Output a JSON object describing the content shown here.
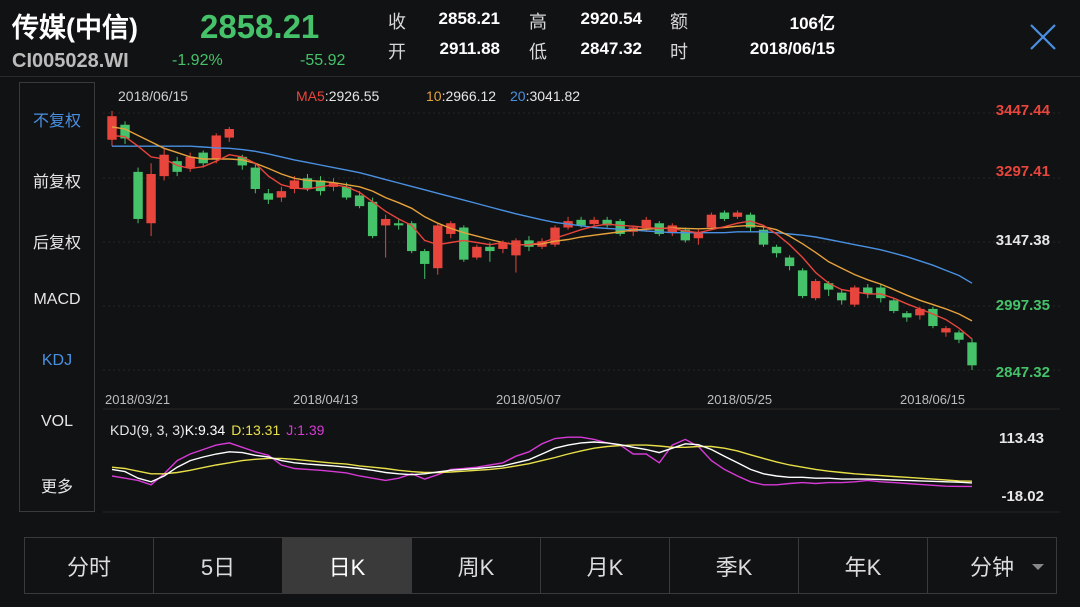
{
  "header": {
    "title": "传媒(中信)",
    "code": "CI005028.WI",
    "price": "2858.21",
    "change_pct": "-1.92%",
    "change": "-55.92",
    "quote": [
      {
        "label": "收",
        "value": "2858.21"
      },
      {
        "label": "开",
        "value": "2911.88"
      },
      {
        "label": "高",
        "value": "2920.54"
      },
      {
        "label": "低",
        "value": "2847.32"
      },
      {
        "label": "额",
        "value": "106亿"
      },
      {
        "label": "时",
        "value": "2018/06/15"
      }
    ]
  },
  "sidebar": {
    "items": [
      {
        "label": "不复权",
        "active": true
      },
      {
        "label": "前复权",
        "active": false
      },
      {
        "label": "后复权",
        "active": false
      },
      {
        "label": "MACD",
        "active": false
      },
      {
        "label": "KDJ",
        "active": true
      },
      {
        "label": "VOL",
        "active": false
      },
      {
        "label": "更多",
        "active": false
      }
    ]
  },
  "tabs": [
    {
      "label": "分时",
      "active": false
    },
    {
      "label": "5日",
      "active": false
    },
    {
      "label": "日K",
      "active": true
    },
    {
      "label": "周K",
      "active": false
    },
    {
      "label": "月K",
      "active": false
    },
    {
      "label": "季K",
      "active": false
    },
    {
      "label": "年K",
      "active": false
    },
    {
      "label": "分钟",
      "active": false,
      "dropdown": true
    }
  ],
  "icons": {
    "close": "close-icon",
    "dropdown": "caret-down-icon"
  },
  "colors": {
    "up": "#e8453c",
    "down": "#45c26a",
    "ma5": "#e8453c",
    "ma10": "#e6a23c",
    "ma20": "#4a90e2",
    "k": "#ffffff",
    "d": "#e8e04a",
    "j": "#d63ad6",
    "accent": "#4a90e2"
  },
  "chart_data": [
    {
      "type": "candlestick",
      "title": "",
      "date_label": "2018/06/15",
      "ma_legend": [
        {
          "name": "MA5",
          "value": "2926.55"
        },
        {
          "name": "10",
          "value": "2966.12"
        },
        {
          "name": "20",
          "value": "3041.82"
        }
      ],
      "y_ticks": [
        "3447.44",
        "3297.41",
        "3147.38",
        "2997.35",
        "2847.32"
      ],
      "ylim": [
        2847.32,
        3447.44
      ],
      "x_ticks": [
        "2018/03/21",
        "2018/04/13",
        "2018/05/07",
        "2018/05/25",
        "2018/06/15"
      ],
      "x_tick_index": [
        0,
        16,
        32,
        48,
        64
      ],
      "candles": [
        {
          "o": 3385,
          "c": 3440,
          "h": 3452,
          "l": 3370
        },
        {
          "o": 3420,
          "c": 3388,
          "h": 3428,
          "l": 3375
        },
        {
          "o": 3310,
          "c": 3200,
          "h": 3320,
          "l": 3190
        },
        {
          "o": 3190,
          "c": 3305,
          "h": 3330,
          "l": 3160
        },
        {
          "o": 3300,
          "c": 3350,
          "h": 3365,
          "l": 3290
        },
        {
          "o": 3335,
          "c": 3310,
          "h": 3345,
          "l": 3300
        },
        {
          "o": 3320,
          "c": 3345,
          "h": 3355,
          "l": 3310
        },
        {
          "o": 3355,
          "c": 3330,
          "h": 3360,
          "l": 3320
        },
        {
          "o": 3340,
          "c": 3395,
          "h": 3400,
          "l": 3330
        },
        {
          "o": 3390,
          "c": 3410,
          "h": 3415,
          "l": 3380
        },
        {
          "o": 3345,
          "c": 3325,
          "h": 3350,
          "l": 3315
        },
        {
          "o": 3320,
          "c": 3270,
          "h": 3330,
          "l": 3260
        },
        {
          "o": 3260,
          "c": 3245,
          "h": 3270,
          "l": 3235
        },
        {
          "o": 3250,
          "c": 3265,
          "h": 3275,
          "l": 3240
        },
        {
          "o": 3270,
          "c": 3290,
          "h": 3300,
          "l": 3260
        },
        {
          "o": 3295,
          "c": 3270,
          "h": 3305,
          "l": 3265
        },
        {
          "o": 3290,
          "c": 3265,
          "h": 3300,
          "l": 3255
        },
        {
          "o": 3275,
          "c": 3285,
          "h": 3295,
          "l": 3265
        },
        {
          "o": 3275,
          "c": 3250,
          "h": 3285,
          "l": 3245
        },
        {
          "o": 3255,
          "c": 3230,
          "h": 3265,
          "l": 3225
        },
        {
          "o": 3240,
          "c": 3160,
          "h": 3250,
          "l": 3155
        },
        {
          "o": 3185,
          "c": 3200,
          "h": 3210,
          "l": 3110
        },
        {
          "o": 3190,
          "c": 3185,
          "h": 3200,
          "l": 3175
        },
        {
          "o": 3190,
          "c": 3125,
          "h": 3195,
          "l": 3120
        },
        {
          "o": 3125,
          "c": 3095,
          "h": 3130,
          "l": 3060
        },
        {
          "o": 3085,
          "c": 3185,
          "h": 3190,
          "l": 3070
        },
        {
          "o": 3165,
          "c": 3190,
          "h": 3195,
          "l": 3155
        },
        {
          "o": 3180,
          "c": 3105,
          "h": 3185,
          "l": 3100
        },
        {
          "o": 3110,
          "c": 3135,
          "h": 3140,
          "l": 3105
        },
        {
          "o": 3135,
          "c": 3125,
          "h": 3145,
          "l": 3100
        },
        {
          "o": 3130,
          "c": 3145,
          "h": 3150,
          "l": 3120
        },
        {
          "o": 3115,
          "c": 3150,
          "h": 3155,
          "l": 3075
        },
        {
          "o": 3150,
          "c": 3135,
          "h": 3160,
          "l": 3125
        },
        {
          "o": 3135,
          "c": 3148,
          "h": 3155,
          "l": 3130
        },
        {
          "o": 3140,
          "c": 3180,
          "h": 3185,
          "l": 3135
        },
        {
          "o": 3180,
          "c": 3195,
          "h": 3205,
          "l": 3175
        },
        {
          "o": 3198,
          "c": 3185,
          "h": 3205,
          "l": 3180
        },
        {
          "o": 3188,
          "c": 3198,
          "h": 3205,
          "l": 3183
        },
        {
          "o": 3198,
          "c": 3185,
          "h": 3205,
          "l": 3180
        },
        {
          "o": 3195,
          "c": 3165,
          "h": 3200,
          "l": 3160
        },
        {
          "o": 3170,
          "c": 3180,
          "h": 3185,
          "l": 3160
        },
        {
          "o": 3178,
          "c": 3198,
          "h": 3205,
          "l": 3170
        },
        {
          "o": 3190,
          "c": 3165,
          "h": 3195,
          "l": 3160
        },
        {
          "o": 3168,
          "c": 3185,
          "h": 3190,
          "l": 3160
        },
        {
          "o": 3175,
          "c": 3150,
          "h": 3180,
          "l": 3145
        },
        {
          "o": 3155,
          "c": 3170,
          "h": 3175,
          "l": 3140
        },
        {
          "o": 3180,
          "c": 3210,
          "h": 3215,
          "l": 3175
        },
        {
          "o": 3215,
          "c": 3200,
          "h": 3220,
          "l": 3195
        },
        {
          "o": 3205,
          "c": 3215,
          "h": 3220,
          "l": 3200
        },
        {
          "o": 3210,
          "c": 3180,
          "h": 3215,
          "l": 3170
        },
        {
          "o": 3175,
          "c": 3140,
          "h": 3180,
          "l": 3135
        },
        {
          "o": 3135,
          "c": 3120,
          "h": 3140,
          "l": 3110
        },
        {
          "o": 3110,
          "c": 3090,
          "h": 3115,
          "l": 3080
        },
        {
          "o": 3080,
          "c": 3020,
          "h": 3085,
          "l": 3015
        },
        {
          "o": 3015,
          "c": 3055,
          "h": 3060,
          "l": 3010
        },
        {
          "o": 3050,
          "c": 3035,
          "h": 3055,
          "l": 3020
        },
        {
          "o": 3028,
          "c": 3010,
          "h": 3035,
          "l": 3000
        },
        {
          "o": 3000,
          "c": 3040,
          "h": 3045,
          "l": 2995
        },
        {
          "o": 3040,
          "c": 3025,
          "h": 3048,
          "l": 3015
        },
        {
          "o": 3040,
          "c": 3015,
          "h": 3048,
          "l": 3005
        },
        {
          "o": 3010,
          "c": 2985,
          "h": 3015,
          "l": 2980
        },
        {
          "o": 2980,
          "c": 2970,
          "h": 2985,
          "l": 2960
        },
        {
          "o": 2975,
          "c": 2990,
          "h": 2995,
          "l": 2965
        },
        {
          "o": 2990,
          "c": 2950,
          "h": 2995,
          "l": 2945
        },
        {
          "o": 2935,
          "c": 2945,
          "h": 2950,
          "l": 2925
        },
        {
          "o": 2935,
          "c": 2918,
          "h": 2940,
          "l": 2910
        },
        {
          "o": 2911.88,
          "c": 2858.21,
          "h": 2920.54,
          "l": 2847.32
        }
      ],
      "ma5": [
        3395,
        3392,
        3370,
        3345,
        3340,
        3325,
        3318,
        3322,
        3335,
        3350,
        3345,
        3330,
        3300,
        3280,
        3272,
        3270,
        3275,
        3280,
        3275,
        3262,
        3240,
        3218,
        3200,
        3185,
        3150,
        3140,
        3145,
        3150,
        3145,
        3140,
        3145,
        3140,
        3140,
        3145,
        3155,
        3165,
        3175,
        3183,
        3188,
        3185,
        3183,
        3180,
        3178,
        3178,
        3172,
        3168,
        3175,
        3182,
        3190,
        3195,
        3185,
        3165,
        3140,
        3110,
        3075,
        3050,
        3035,
        3030,
        3025,
        3025,
        3015,
        3002,
        2990,
        2978,
        2965,
        2945,
        2920
      ],
      "ma10": [
        3415,
        3410,
        3395,
        3380,
        3365,
        3355,
        3345,
        3340,
        3340,
        3340,
        3338,
        3330,
        3318,
        3305,
        3295,
        3290,
        3288,
        3285,
        3280,
        3275,
        3265,
        3250,
        3238,
        3225,
        3205,
        3190,
        3178,
        3168,
        3160,
        3152,
        3145,
        3140,
        3140,
        3142,
        3148,
        3152,
        3158,
        3162,
        3166,
        3170,
        3174,
        3176,
        3178,
        3179,
        3178,
        3177,
        3178,
        3180,
        3183,
        3185,
        3182,
        3175,
        3160,
        3142,
        3122,
        3100,
        3085,
        3070,
        3058,
        3048,
        3035,
        3022,
        3010,
        3000,
        2990,
        2978,
        2962
      ],
      "ma20": [
        3370,
        3370,
        3370,
        3370,
        3370,
        3370,
        3370,
        3368,
        3366,
        3365,
        3362,
        3358,
        3352,
        3345,
        3338,
        3332,
        3326,
        3320,
        3314,
        3308,
        3300,
        3292,
        3284,
        3276,
        3268,
        3260,
        3252,
        3244,
        3236,
        3228,
        3220,
        3212,
        3205,
        3198,
        3192,
        3188,
        3184,
        3180,
        3178,
        3176,
        3174,
        3172,
        3170,
        3168,
        3168,
        3168,
        3168,
        3168,
        3170,
        3170,
        3170,
        3168,
        3165,
        3162,
        3158,
        3152,
        3146,
        3140,
        3134,
        3128,
        3120,
        3112,
        3102,
        3092,
        3080,
        3068,
        3050
      ]
    },
    {
      "type": "line",
      "title": "",
      "legend_prefix": "KDJ(9, 3, 3)",
      "legend": [
        {
          "name": "K",
          "value": "9.34"
        },
        {
          "name": "D",
          "value": "13.31"
        },
        {
          "name": "J",
          "value": "1.39"
        }
      ],
      "y_ticks": [
        "113.43",
        "-18.02"
      ],
      "ylim": [
        -18.02,
        113.43
      ],
      "K": [
        40,
        35,
        20,
        12,
        25,
        45,
        60,
        68,
        75,
        80,
        78,
        72,
        68,
        60,
        55,
        52,
        50,
        48,
        45,
        42,
        38,
        33,
        30,
        28,
        30,
        34,
        38,
        40,
        42,
        45,
        48,
        55,
        62,
        75,
        88,
        95,
        100,
        102,
        100,
        96,
        90,
        85,
        78,
        88,
        98,
        96,
        85,
        70,
        55,
        40,
        30,
        25,
        22,
        22,
        20,
        20,
        18,
        18,
        18,
        17,
        16,
        15,
        14,
        13,
        12,
        11,
        9.34
      ],
      "D": [
        45,
        42,
        36,
        30,
        30,
        33,
        38,
        44,
        50,
        55,
        60,
        63,
        65,
        65,
        63,
        60,
        57,
        54,
        52,
        48,
        45,
        42,
        38,
        35,
        33,
        33,
        34,
        36,
        38,
        40,
        43,
        48,
        53,
        60,
        67,
        75,
        82,
        88,
        92,
        94,
        95,
        95,
        93,
        90,
        90,
        92,
        92,
        88,
        82,
        73,
        65,
        57,
        50,
        45,
        40,
        36,
        33,
        30,
        28,
        26,
        24,
        22,
        20,
        18,
        16,
        14,
        13.31
      ],
      "J": [
        25,
        20,
        15,
        5,
        30,
        60,
        75,
        85,
        95,
        100,
        90,
        80,
        72,
        50,
        42,
        40,
        38,
        35,
        32,
        25,
        20,
        15,
        20,
        30,
        18,
        28,
        40,
        42,
        45,
        50,
        55,
        70,
        80,
        98,
        110,
        113,
        113,
        108,
        100,
        95,
        75,
        75,
        55,
        95,
        108,
        92,
        60,
        40,
        25,
        12,
        5,
        5,
        8,
        10,
        8,
        10,
        10,
        12,
        15,
        12,
        10,
        8,
        6,
        4,
        2,
        1.5,
        1.39
      ]
    }
  ]
}
